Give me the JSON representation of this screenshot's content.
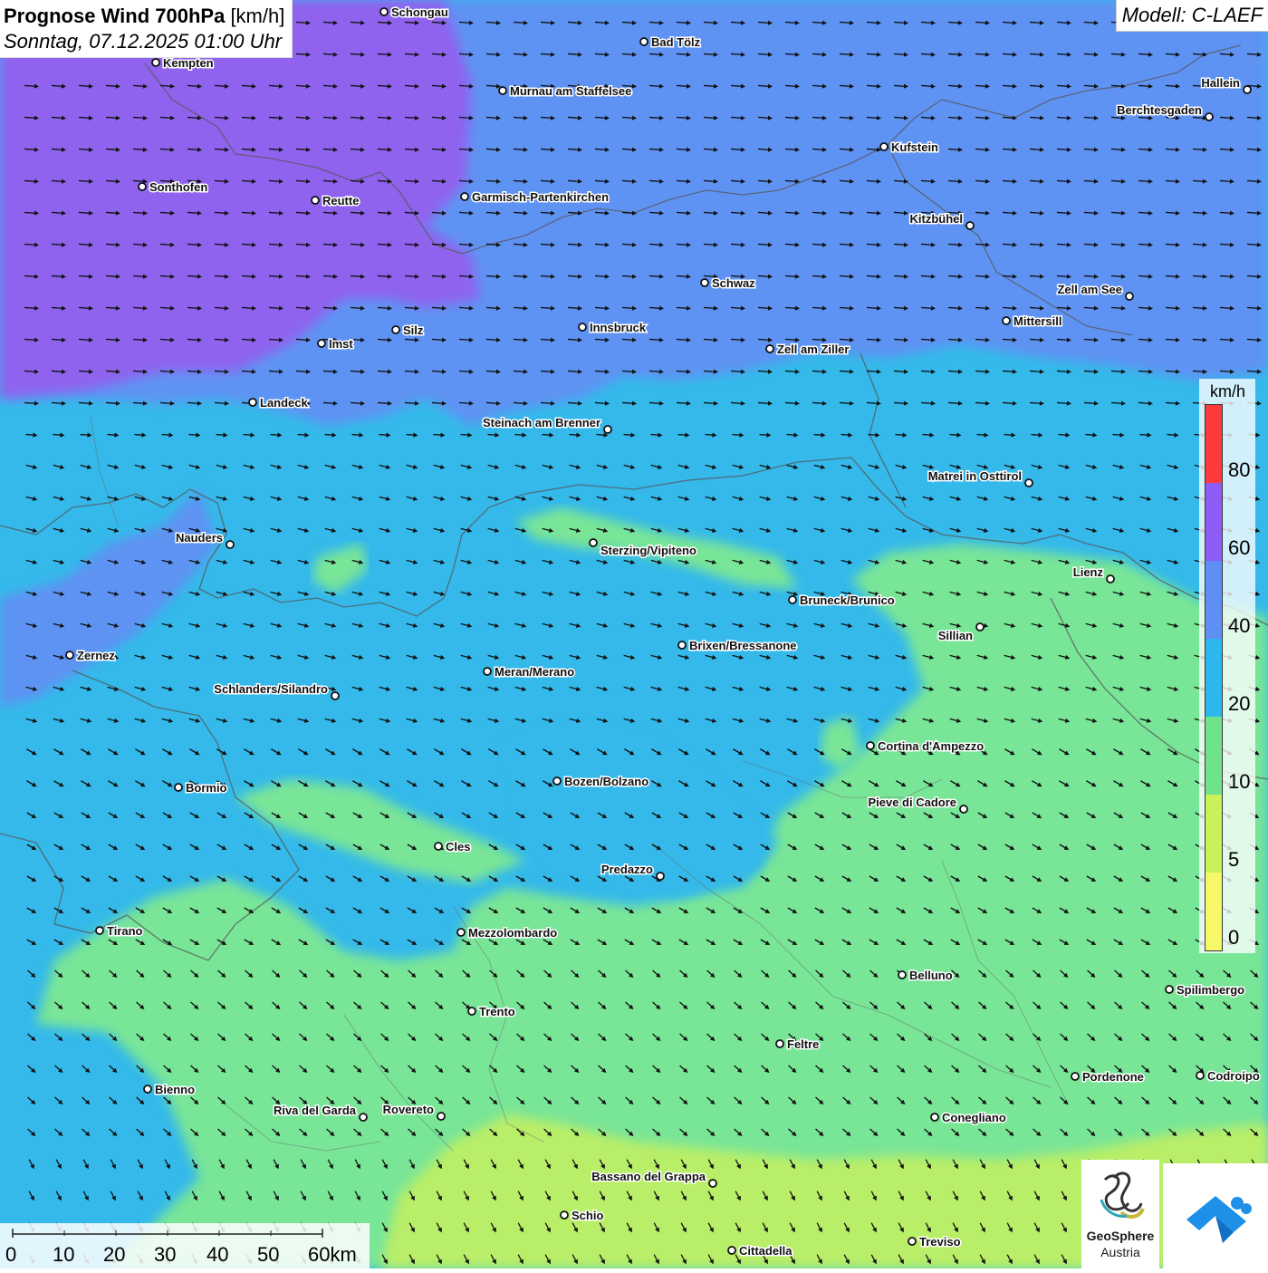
{
  "title": {
    "main": "Prognose Wind 700hPa",
    "unit": "[km/h]",
    "datetime": "Sonntag, 07.12.2025 01:00 Uhr"
  },
  "model": "Modell: C-LAEF",
  "legend": {
    "unit": "km/h",
    "labels": [
      "80",
      "60",
      "40",
      "20",
      "10",
      "5",
      "0"
    ],
    "colors": [
      "#ff3a3a",
      "#8e5cf5",
      "#5f8ff5",
      "#2cb8ee",
      "#6fe38c",
      "#c8f25a",
      "#f7f76a"
    ]
  },
  "scalebar": {
    "labels": [
      "0",
      "10",
      "20",
      "30",
      "40",
      "50",
      "60km"
    ]
  },
  "logos": {
    "geosphere_line1": "GeoSphere",
    "geosphere_line2": "Austria"
  },
  "icons": {
    "geosphere": "geosphere-logo-icon",
    "app": "cloud-arrow-logo-icon"
  },
  "cities": [
    {
      "name": "Schongau",
      "label": "Schongau"
    },
    {
      "name": "Bad Tölz",
      "label": "Bad Tölz"
    },
    {
      "name": "Kempten",
      "label": "Kempten"
    },
    {
      "name": "Murnau am Staffelsee",
      "label": "Murnau am Staffelsee"
    },
    {
      "name": "Hallein",
      "label": "Hallein"
    },
    {
      "name": "Berchtesgaden",
      "label": "Berchtesgaden"
    },
    {
      "name": "Kufstein",
      "label": "Kufstein"
    },
    {
      "name": "Sonthofen",
      "label": "Sonthofen"
    },
    {
      "name": "Reutte",
      "label": "Reutte"
    },
    {
      "name": "Garmisch-Partenkirchen",
      "label": "Garmisch-Partenkirchen"
    },
    {
      "name": "Kitzbühel",
      "label": "Kitzbühel"
    },
    {
      "name": "Schwaz",
      "label": "Schwaz"
    },
    {
      "name": "Zell am See",
      "label": "Zell am See"
    },
    {
      "name": "Mittersill",
      "label": "Mittersill"
    },
    {
      "name": "Innsbruck",
      "label": "Innsbruck"
    },
    {
      "name": "Silz",
      "label": "Silz"
    },
    {
      "name": "Imst",
      "label": "Imst"
    },
    {
      "name": "Zell am Ziller",
      "label": "Zell am Ziller"
    },
    {
      "name": "Landeck",
      "label": "Landeck"
    },
    {
      "name": "Steinach am Brenner",
      "label": "Steinach am Brenner"
    },
    {
      "name": "Matrei in Osttirol",
      "label": "Matrei in Osttirol"
    },
    {
      "name": "Nauders",
      "label": "Nauders"
    },
    {
      "name": "Sterzing/Vipiteno",
      "label": "Sterzing/Vipiteno"
    },
    {
      "name": "Lienz",
      "label": "Lienz"
    },
    {
      "name": "Bruneck/Brunico",
      "label": "Bruneck/Brunico"
    },
    {
      "name": "Sillian",
      "label": "Sillian"
    },
    {
      "name": "Zernez",
      "label": "Zernez"
    },
    {
      "name": "Brixen/Bressanone",
      "label": "Brixen/Bressanone"
    },
    {
      "name": "Meran/Merano",
      "label": "Meran/Merano"
    },
    {
      "name": "Schlanders/Silandro",
      "label": "Schlanders/Silandro"
    },
    {
      "name": "Cortina d'Ampezzo",
      "label": "Cortina d'Ampezzo"
    },
    {
      "name": "Bozen/Bolzano",
      "label": "Bozen/Bolzano"
    },
    {
      "name": "Bormio",
      "label": "Bormio"
    },
    {
      "name": "Pieve di Cadore",
      "label": "Pieve di Cadore"
    },
    {
      "name": "Cles",
      "label": "Cles"
    },
    {
      "name": "Predazzo",
      "label": "Predazzo"
    },
    {
      "name": "Tirano",
      "label": "Tirano"
    },
    {
      "name": "Mezzolombardo",
      "label": "Mezzolombardo"
    },
    {
      "name": "Belluno",
      "label": "Belluno"
    },
    {
      "name": "Spilimbergo",
      "label": "Spilimbergo"
    },
    {
      "name": "Trento",
      "label": "Trento"
    },
    {
      "name": "Feltre",
      "label": "Feltre"
    },
    {
      "name": "Pordenone",
      "label": "Pordenone"
    },
    {
      "name": "Codroipo",
      "label": "Codroipo"
    },
    {
      "name": "Bienno",
      "label": "Bienno"
    },
    {
      "name": "Riva del Garda",
      "label": "Riva del Garda"
    },
    {
      "name": "Rovereto",
      "label": "Rovereto"
    },
    {
      "name": "Conegliano",
      "label": "Conegliano"
    },
    {
      "name": "Bassano del Grappa",
      "label": "Bassano del Grappa"
    },
    {
      "name": "Schio",
      "label": "Schio"
    },
    {
      "name": "Treviso",
      "label": "Treviso"
    },
    {
      "name": "Cittadella",
      "label": "Cittadella"
    }
  ]
}
